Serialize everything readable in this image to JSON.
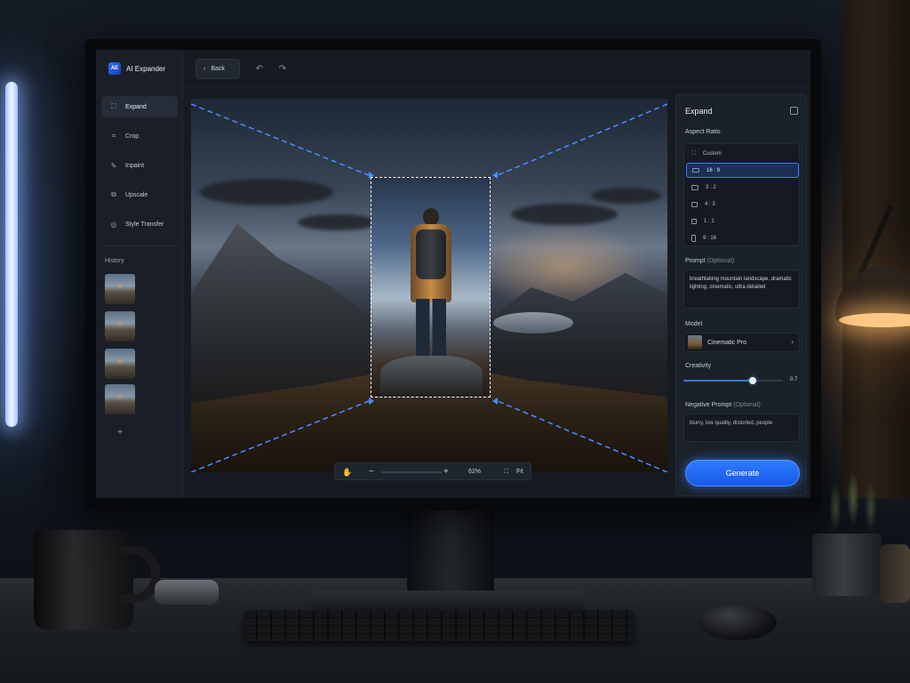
{
  "app": {
    "brand_name": "AI Expander",
    "brand_logo": "AE"
  },
  "topbar": {
    "back_label": "Back",
    "icons": [
      "chevron-left-icon",
      "undo-icon",
      "redo-icon",
      "gear-icon",
      "avatar"
    ]
  },
  "sidebar": {
    "items": [
      {
        "label": "Expand",
        "icon": "expand-icon",
        "active": true
      },
      {
        "label": "Crop",
        "icon": "crop-icon",
        "active": false
      },
      {
        "label": "Inpaint",
        "icon": "brush-icon",
        "active": false
      },
      {
        "label": "Upscale",
        "icon": "upscale-icon",
        "active": false
      },
      {
        "label": "Style Transfer",
        "icon": "style-icon",
        "active": false
      }
    ],
    "history_title": "History",
    "history_count": 4,
    "history_add": "+"
  },
  "canvas": {
    "zoom_level": "62%",
    "fit_label": "Fit",
    "zoom_minus": "−",
    "zoom_plus": "+"
  },
  "panel": {
    "title": "Expand",
    "aspect_ratio_label": "Aspect Ratio",
    "ratios": [
      {
        "label": "Custom",
        "selected": false
      },
      {
        "label": "16 : 9",
        "selected": true
      },
      {
        "label": "3 : 2",
        "selected": false
      },
      {
        "label": "4 : 3",
        "selected": false
      },
      {
        "label": "1 : 1",
        "selected": false
      },
      {
        "label": "9 : 16",
        "selected": false
      }
    ],
    "prompt_label": "Prompt",
    "prompt_optional": "(Optional)",
    "prompt_value": "breathtaking mountain landscape, dramatic lighting, cinematic, ultra detailed",
    "model_label": "Model",
    "model_value": "Cinematic Pro",
    "creativity_label": "Creativity",
    "creativity_value": "0.7",
    "creativity_fraction": 0.7,
    "negative_label": "Negative Prompt",
    "negative_optional": "(Optional)",
    "negative_value": "blurry, low quality, distorted, people",
    "generate_label": "Generate"
  },
  "colors": {
    "accent": "#2f7bff",
    "panel_bg": "#1b2129",
    "screen_bg": "#161b22"
  }
}
